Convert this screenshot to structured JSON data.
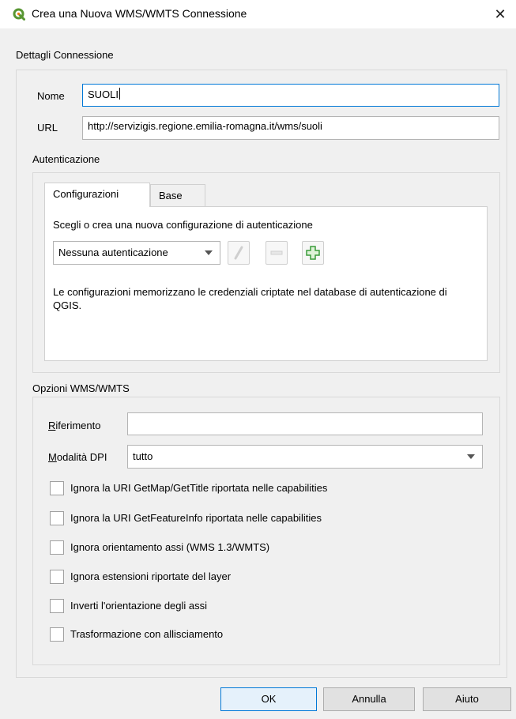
{
  "window": {
    "title": "Crea una Nuova WMS/WMTS Connessione",
    "close_glyph": "✕",
    "app_icon": "qgis-icon"
  },
  "connection": {
    "group_title": "Dettagli Connessione",
    "name_label": "Nome",
    "name_value": "SUOLI",
    "url_label": "URL",
    "url_value": "http://servizigis.regione.emilia-romagna.it/wms/suoli"
  },
  "auth": {
    "group_title": "Autenticazione",
    "tabs": [
      {
        "label": "Configurazioni",
        "active": true
      },
      {
        "label": "Base",
        "active": false
      }
    ],
    "prompt": "Scegli o crea una nuova configurazione di autenticazione",
    "combo_value": "Nessuna autenticazione",
    "tools": [
      "edit-icon",
      "remove-icon",
      "add-icon"
    ],
    "info_text": "Le configurazioni memorizzano le credenziali criptate nel database di autenticazione di QGIS."
  },
  "options": {
    "group_title": "Opzioni WMS/WMTS",
    "referer_label_first": "R",
    "referer_label_rest": "iferimento",
    "referer_value": "",
    "dpi_label_first": "M",
    "dpi_label_rest": "odalità DPI",
    "dpi_value": "tutto",
    "checkboxes": [
      {
        "label": "Ignora la URI GetMap/GetTitle riportata nelle capabilities",
        "checked": false
      },
      {
        "label": "Ignora la URI GetFeatureInfo riportata nelle capabilities",
        "checked": false
      },
      {
        "label": "Ignora orientamento assi (WMS 1.3/WMTS)",
        "checked": false
      },
      {
        "label": "Ignora estensioni riportate del layer",
        "checked": false
      },
      {
        "label": "Inverti l'orientazione degli assi",
        "checked": false
      },
      {
        "label": "Trasformazione con allisciamento",
        "checked": false
      }
    ]
  },
  "buttons": {
    "ok": "OK",
    "cancel": "Annulla",
    "help": "Aiuto"
  },
  "colors": {
    "accent": "#0078d7",
    "qgis_green": "#589632",
    "qgis_yellow": "#ee7913",
    "add_green": "#3a9b3a"
  }
}
